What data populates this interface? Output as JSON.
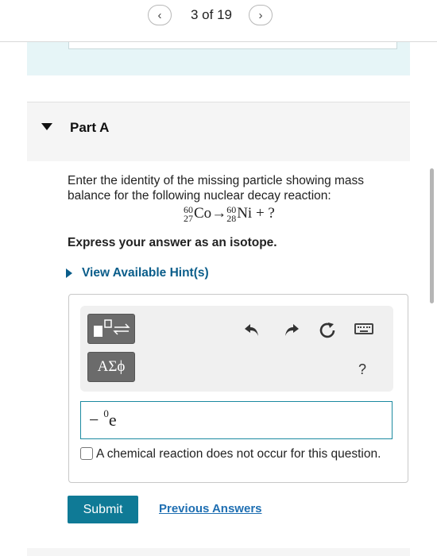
{
  "nav": {
    "prev_icon": "chevron-left-icon",
    "next_icon": "chevron-right-icon",
    "counter": "3 of 19"
  },
  "part": {
    "title": "Part A"
  },
  "question": {
    "text": "Enter the identity of the missing particle showing mass balance for the following nuclear decay reaction:",
    "equation": {
      "reactant": {
        "mass": "60",
        "atomic": "27",
        "symbol": "Co"
      },
      "arrow": "→",
      "product": {
        "mass": "60",
        "atomic": "28",
        "symbol": "Ni"
      },
      "plus": "+",
      "unknown": "?"
    }
  },
  "instruction": "Express your answer as an isotope.",
  "hint_link": "View Available Hint(s)",
  "toolbar": {
    "greek_label": "ΑΣϕ",
    "help_label": "?",
    "icons": [
      "template-icon",
      "undo-icon",
      "redo-icon",
      "reset-icon",
      "keyboard-icon"
    ]
  },
  "answer": {
    "prefix": "−",
    "superscript": "0",
    "symbol": "e"
  },
  "no_reaction_label": "A chemical reaction does not occur for this question.",
  "submit_label": "Submit",
  "previous_answers_label": "Previous Answers",
  "colors": {
    "accent": "#0f7a96",
    "link": "#1f6fb2",
    "teal_bg": "#e6f5f7"
  }
}
